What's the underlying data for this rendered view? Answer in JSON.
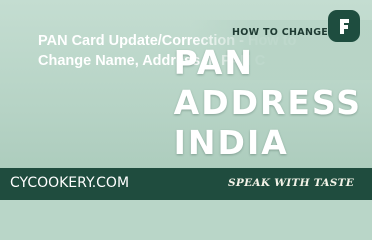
{
  "thumbnail": {
    "link_title_line1": "PAN Card Update/Correction - How to",
    "link_title_line2": "Change Name, Address in PAN C",
    "kicker": "HOW TO CHANGE",
    "headline_lines": [
      "PAN",
      "ADDRESS",
      "INDIA"
    ],
    "logo_icon": "f-logo-icon"
  },
  "footer": {
    "site": "CYCOOKERY.COM",
    "tagline": "SPEAK WITH TASTE"
  },
  "colors": {
    "background": "#b9d6c8",
    "footer": "#1f4c3e",
    "logo": "#1e4d3f",
    "headline": "#ffffff"
  }
}
